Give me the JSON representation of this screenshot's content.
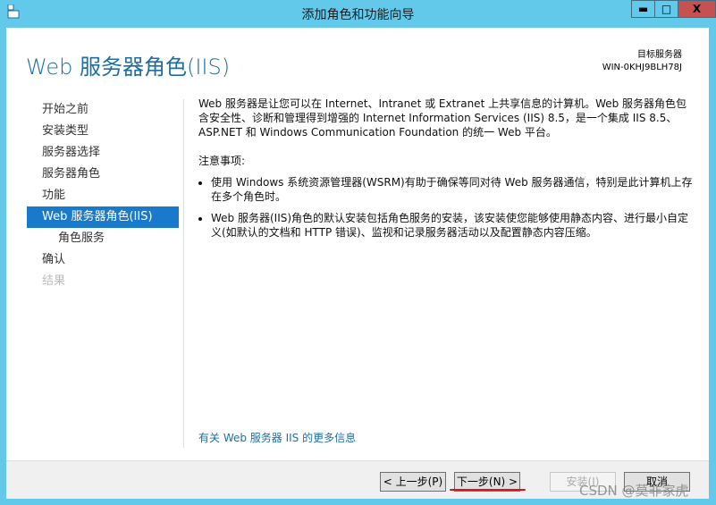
{
  "window": {
    "title": "添加角色和功能向导",
    "minimize": "▬",
    "maximize": "□",
    "close": "X"
  },
  "header": {
    "title": "Web 服务器角色(IIS)",
    "target_label": "目标服务器",
    "target_value": "WIN-0KHJ9BLH78J"
  },
  "nav": [
    {
      "label": "开始之前",
      "state": "normal"
    },
    {
      "label": "安装类型",
      "state": "normal"
    },
    {
      "label": "服务器选择",
      "state": "normal"
    },
    {
      "label": "服务器角色",
      "state": "normal"
    },
    {
      "label": "功能",
      "state": "normal"
    },
    {
      "label": "Web 服务器角色(IIS)",
      "state": "selected"
    },
    {
      "label": "角色服务",
      "state": "sub"
    },
    {
      "label": "确认",
      "state": "normal"
    },
    {
      "label": "结果",
      "state": "disabled"
    }
  ],
  "content": {
    "intro": "Web 服务器是让您可以在 Internet、Intranet 或 Extranet 上共享信息的计算机。Web 服务器角色包含安全性、诊断和管理得到增强的 Internet Information Services (IIS) 8.5，是一个集成 IIS 8.5、ASP.NET 和 Windows Communication Foundation 的统一 Web 平台。",
    "notes_title": "注意事项:",
    "notes": [
      "使用 Windows 系统资源管理器(WSRM)有助于确保等同对待 Web 服务器通信，特别是此计算机上存在多个角色时。",
      "Web 服务器(IIS)角色的默认安装包括角色服务的安装，该安装使您能够使用静态内容、进行最小自定义(如默认的文档和 HTTP 错误)、监视和记录服务器活动以及配置静态内容压缩。"
    ],
    "more_link": "有关 Web 服务器 IIS 的更多信息"
  },
  "footer": {
    "prev": "< 上一步(P)",
    "next": "下一步(N) >",
    "install": "安装(I)",
    "cancel": "取消"
  },
  "watermark": "CSDN @莫非家虎",
  "colors": {
    "titlebar": "#63c9ea",
    "selected": "#1979ca",
    "heading": "#1e6f9f",
    "close": "#c75050"
  }
}
